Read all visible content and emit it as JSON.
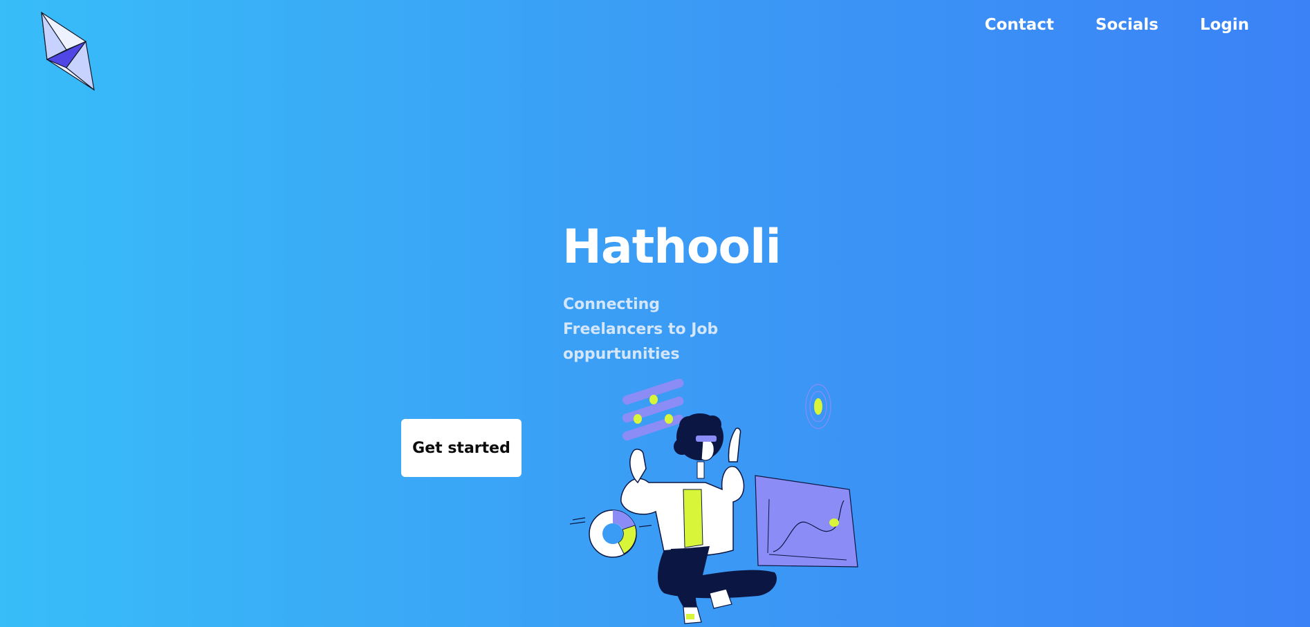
{
  "nav": {
    "contact_label": "Contact",
    "socials_label": "Socials",
    "login_label": "Login"
  },
  "hero": {
    "title": "Hathooli",
    "subtitle": "Connecting Freelancers to Job oppurtunities",
    "cta_label": "Get started"
  },
  "colors": {
    "background_start": "#38bdf8",
    "background_end": "#3b82f6",
    "accent_purple": "#8b8cf6",
    "accent_lime": "#d9f53a",
    "navy": "#0b1642"
  }
}
